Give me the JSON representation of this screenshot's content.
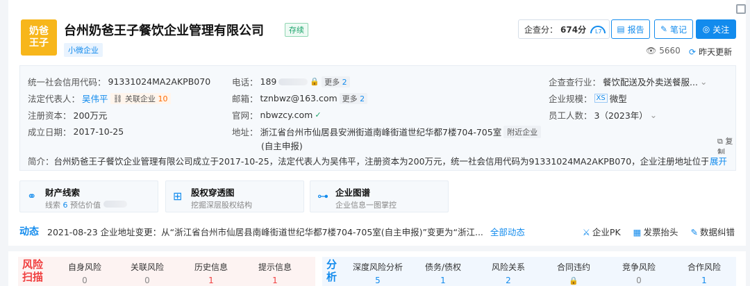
{
  "header": {
    "logo_line1": "奶爸",
    "logo_line2": "王子",
    "company_name": "台州奶爸王子餐饮企业管理有限公司",
    "status": "存续",
    "size_tag": "小微企业",
    "score_label": "企查分：",
    "score_value": "674分",
    "report_label": "报告",
    "note_label": "笔记",
    "follow_label": "关注",
    "views": "5660",
    "updated": "昨天更新"
  },
  "info": {
    "credit_code_label": "统一社会信用代码：",
    "credit_code": "91331024MA2AKPB070",
    "legal_rep_label": "法定代表人：",
    "legal_rep": "吴伟平",
    "related_label": "关联企业",
    "related_count": "10",
    "capital_label": "注册资本：",
    "capital": "200万元",
    "established_label": "成立日期：",
    "established": "2017-10-25",
    "phone_label": "电话：",
    "phone_prefix": "189",
    "phone_more_label": "更多",
    "phone_more_count": "2",
    "email_label": "邮箱：",
    "email": "tznbwz@163.com",
    "email_more_label": "更多",
    "email_more_count": "2",
    "website_label": "官网：",
    "website": "nbwzcy.com",
    "address_label": "地址：",
    "address_line1": "浙江省台州市仙居县安洲街道南峰街道世纪华都7楼704-705室",
    "address_line2": "(自主申报)",
    "nearby_label": "附近企业",
    "industry_label": "企查查行业：",
    "industry": "餐饮配送及外卖送餐服...",
    "scale_label": "企业规模：",
    "scale_tag": "XS",
    "scale": "微型",
    "staff_label": "员工人数：",
    "staff": "3（2023年）",
    "copy_label": "复制",
    "summary_label": "简介：",
    "summary": "台州奶爸王子餐饮企业管理有限公司成立于2017-10-25，法定代表人为吴伟平，注册资本为200万元，统一社会信用代码为91331024MA2AKPB070，企业注册地址位于浙江...",
    "expand_label": "展开"
  },
  "features": [
    {
      "title": "财产线索",
      "sub_prefix": "线索",
      "sub_count": "6",
      "sub_suffix": "预估价值"
    },
    {
      "title": "股权穿透图",
      "sub": "挖掘深层股权结构"
    },
    {
      "title": "企业图谱",
      "sub": "企业信息一图掌控"
    }
  ],
  "dynamic": {
    "title": "动态",
    "text": "2021-08-23 企业地址变更：从“浙江省台州市仙居县南峰街道世纪华都7楼704-705室(自主申报)”变更为“浙江...",
    "all_label": "全部动态",
    "pk_label": "企业PK",
    "invoice_label": "发票抬头",
    "error_label": "数据纠错"
  },
  "risk": {
    "title": "风险扫描",
    "items": [
      {
        "label": "自身风险",
        "value": "0"
      },
      {
        "label": "关联风险",
        "value": "0"
      },
      {
        "label": "历史信息",
        "value": "1"
      },
      {
        "label": "提示信息",
        "value": "1"
      }
    ]
  },
  "analysis": {
    "title": "分析",
    "items": [
      {
        "label": "深度风险分析",
        "value": "5"
      },
      {
        "label": "债务/债权",
        "value": "1"
      },
      {
        "label": "风险关系",
        "value": "2"
      },
      {
        "label": "合同违约",
        "value": ""
      },
      {
        "label": "竞争风险",
        "value": "0"
      },
      {
        "label": "合作风险",
        "value": "1"
      }
    ]
  }
}
